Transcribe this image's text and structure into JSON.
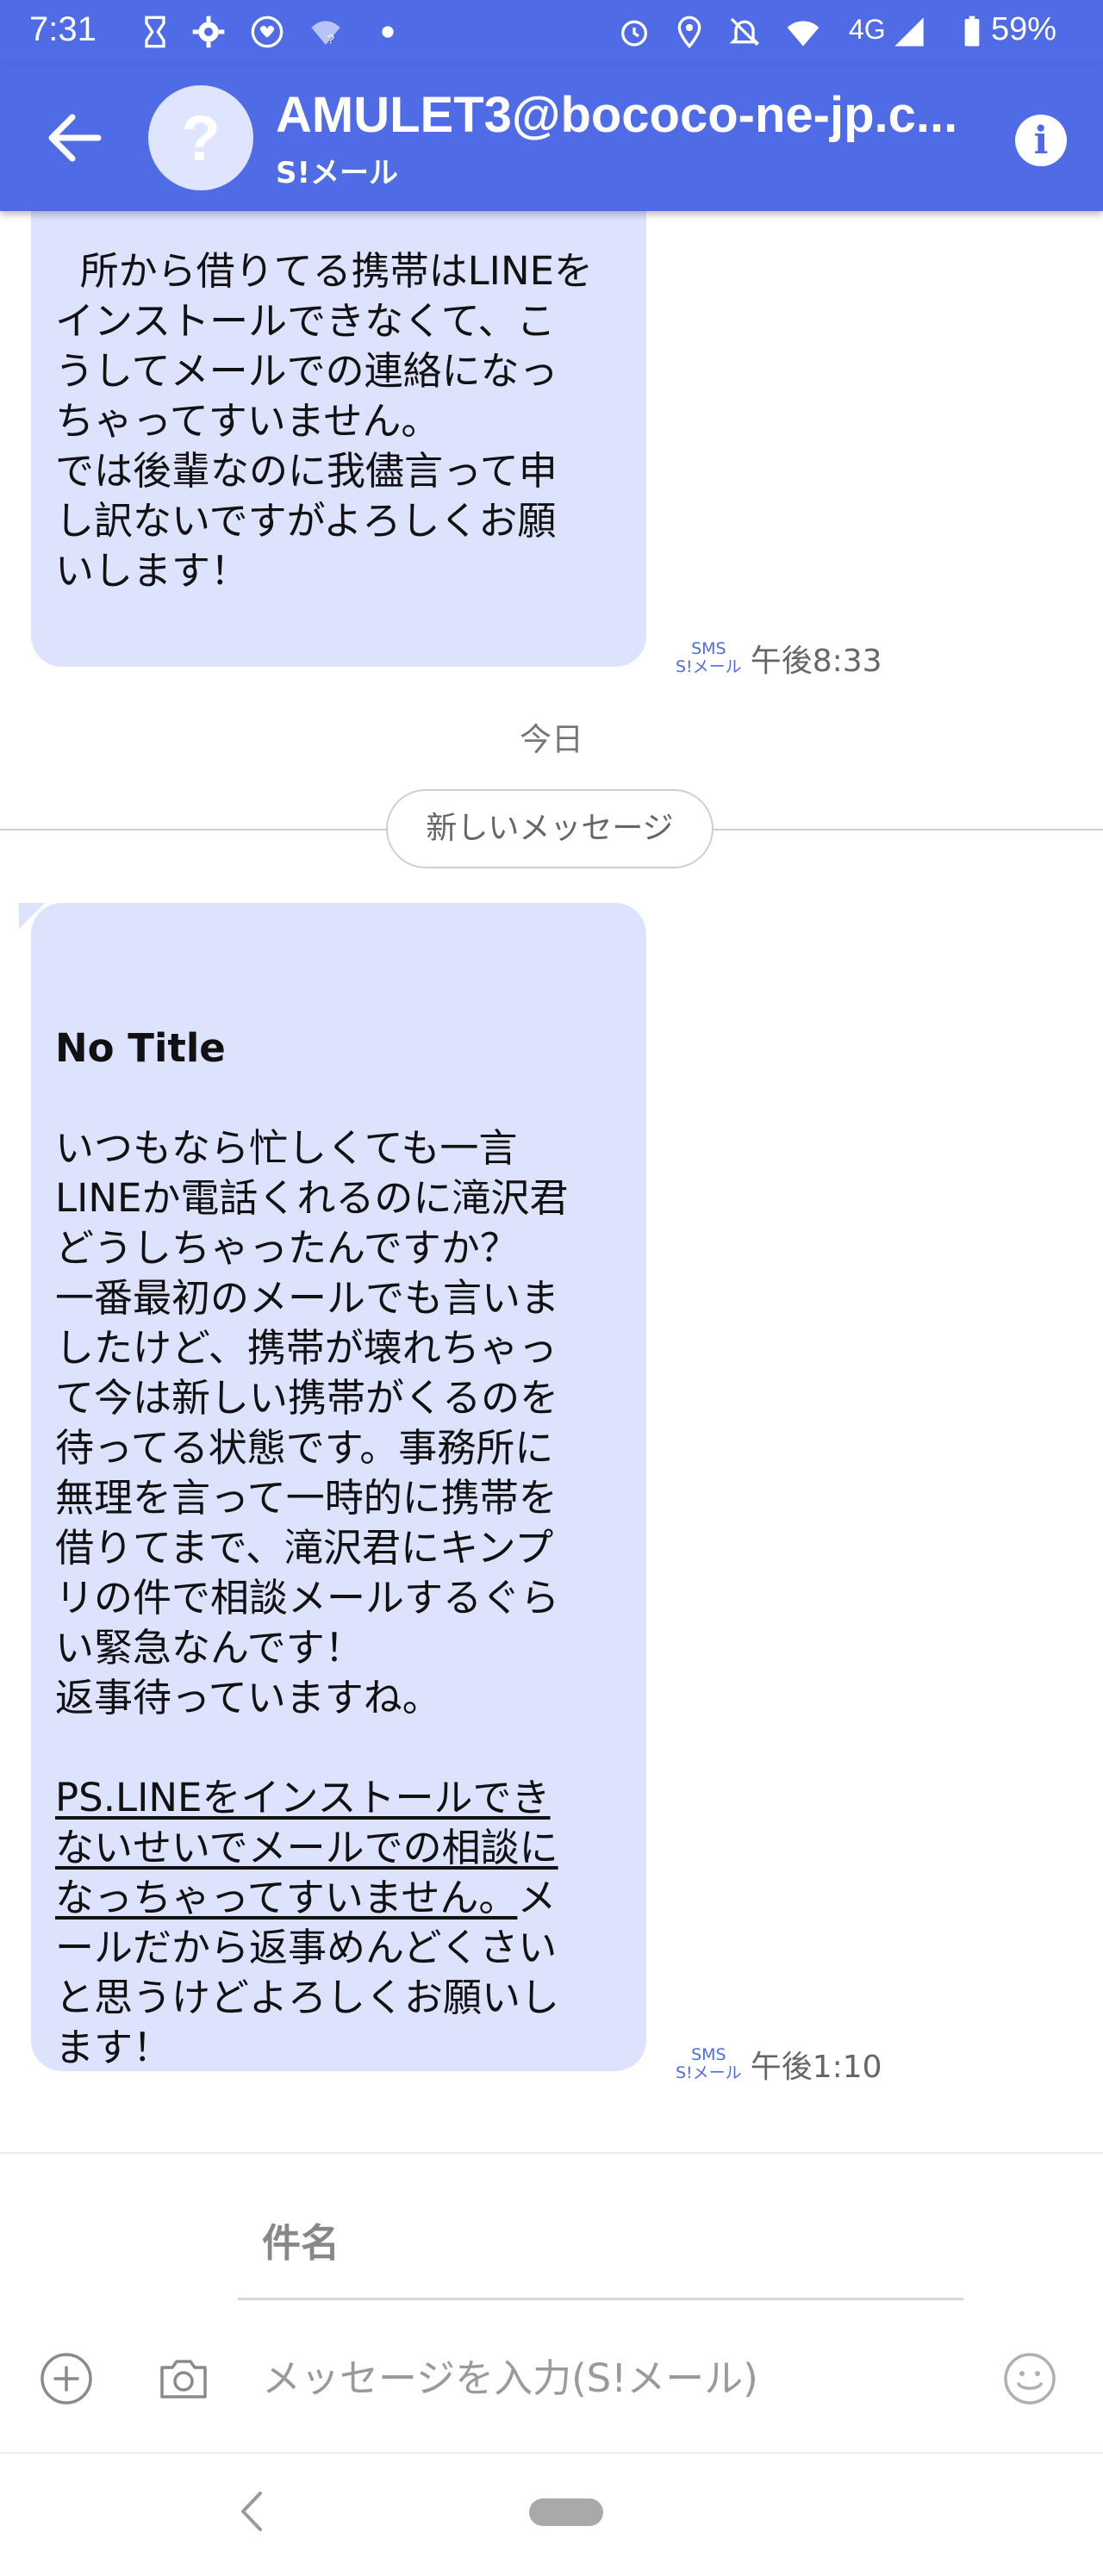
{
  "status_bar": {
    "time": "7:31",
    "network": "4G",
    "battery": "59%"
  },
  "header": {
    "title": "AMULET3@bococo-ne-jp.c...",
    "subtitle": "S!メール",
    "avatar_glyph": "?"
  },
  "messages": [
    {
      "body": "所から借りてる携帯はLINEを\nインストールできなくて、こ\nうしてメールでの連絡になっ\nちゃってすいません。\nでは後輩なのに我儘言って申\nし訳ないですがよろしくお願\nいします！",
      "badge_top": "SMS",
      "badge_bottom": "S!メール",
      "time": "午後8:33"
    },
    {
      "title": "No Title",
      "body": "いつもなら忙しくても一言\nLINEか電話くれるのに滝沢君\nどうしちゃったんですか？\n一番最初のメールでも言いま\nしたけど、携帯が壊れちゃっ\nて今は新しい携帯がくるのを\n待ってる状態です。事務所に\n無理を言って一時的に携帯を\n借りてまで、滝沢君にキンプ\nリの件で相談メールするぐら\nい緊急なんです！\n返事待っていますね。",
      "ps_underlined": "PS.LINEをインストールでき\nないせいでメールでの相談に\nなっちゃってすいません。",
      "ps_rest": "メ\nールだから返事めんどくさい\nと思うけどよろしくお願いし\nます！",
      "badge_top": "SMS",
      "badge_bottom": "S!メール",
      "time": "午後1:10"
    }
  ],
  "day_label": "今日",
  "new_messages_label": "新しいメッセージ",
  "composer": {
    "subject_placeholder": "件名",
    "message_placeholder": "メッセージを入力(S!メール)"
  }
}
